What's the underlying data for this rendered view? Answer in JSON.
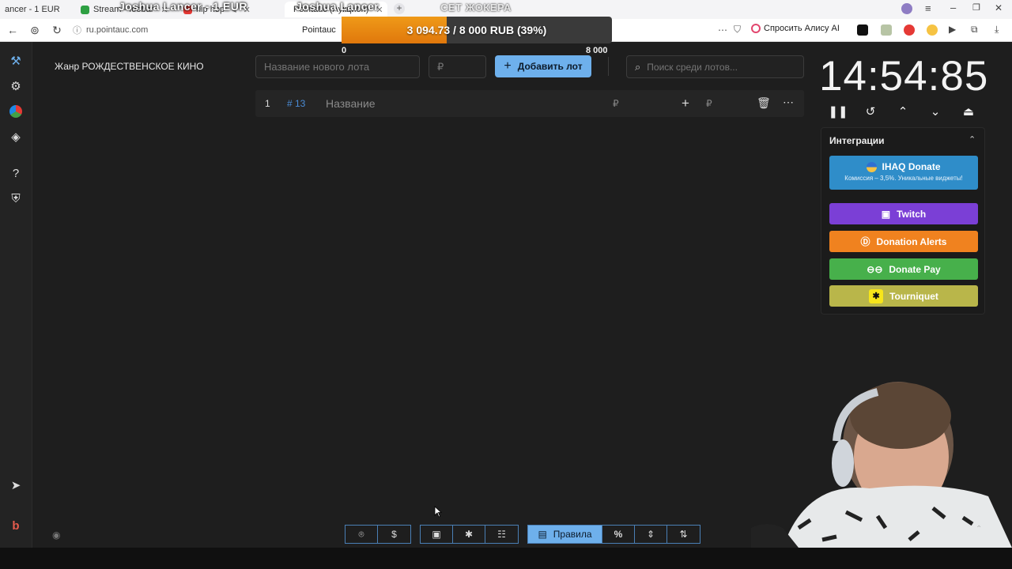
{
  "browser": {
    "tabs": [
      {
        "label": "ancer - 1 EUR"
      },
      {
        "label": "Stream - foobar"
      },
      {
        "label": "hip hop"
      },
      {
        "label": "Pointauc (Аукцион)"
      }
    ],
    "overlay_text_1": "Joshua Lancer - 1 EUR",
    "overlay_text_2": "Joshua Lancer",
    "url": "ru.pointauc.com",
    "page_title": "Pointauc",
    "alice_label": "Спросить Алису AI"
  },
  "goal": {
    "title": "СЕТ ЖОКЕРА",
    "label": "3 094.73 / 8 000 RUB (39%)",
    "progress": 0.39,
    "min_label": "0",
    "max_label": "8 000"
  },
  "app": {
    "genre": "Жанр РОЖДЕСТВЕНСКОЕ КИНО",
    "new_lot_placeholder": "Название нового лота",
    "amount_placeholder": "₽",
    "add_lot_label": "Добавить лот",
    "search_placeholder": "Поиск среди лотов...",
    "lot": {
      "index": "1",
      "id": "# 13",
      "name_placeholder": "Название",
      "currency": "₽",
      "currency2": "₽"
    },
    "timer": "14:54:85",
    "integrations": {
      "title": "Интеграции",
      "ihaq_label": "IHAQ Donate",
      "ihaq_sub": "Комиссия – 3,5%. Уникальные виджеты!",
      "twitch": "Twitch",
      "donation_alerts": "Donation Alerts",
      "donate_pay": "Donate Pay",
      "tourniquet": "Tourniquet"
    },
    "toolbar": {
      "rules_label": "Правила",
      "percent": "%"
    }
  },
  "colors": {
    "accent": "#6eb0ec",
    "ihaq": "#2f8dc9",
    "twitch": "#7b3fd6",
    "donation_alerts": "#f0821f",
    "donate_pay": "#47b04b",
    "tourniquet": "#b9b64a"
  }
}
